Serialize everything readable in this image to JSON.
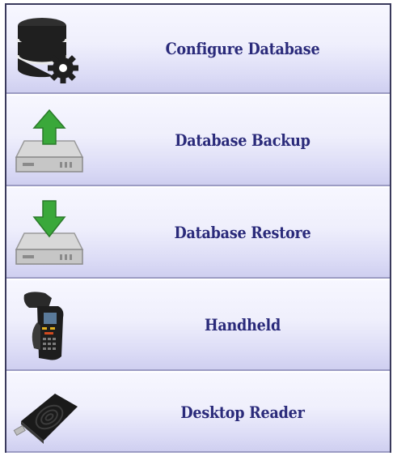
{
  "menu": {
    "items": [
      {
        "label": "Configure Database",
        "icon": "database-gear-icon"
      },
      {
        "label": "Database Backup",
        "icon": "drive-upload-icon"
      },
      {
        "label": "Database Restore",
        "icon": "drive-download-icon"
      },
      {
        "label": "Handheld",
        "icon": "handheld-scanner-icon"
      },
      {
        "label": "Desktop Reader",
        "icon": "desktop-reader-icon"
      }
    ]
  },
  "colors": {
    "label_text": "#2a2a7a",
    "item_gradient_top": "#f7f7ff",
    "item_gradient_bottom": "#cfcff0",
    "border": "#3a3a5c",
    "arrow_green": "#3aa83a"
  }
}
